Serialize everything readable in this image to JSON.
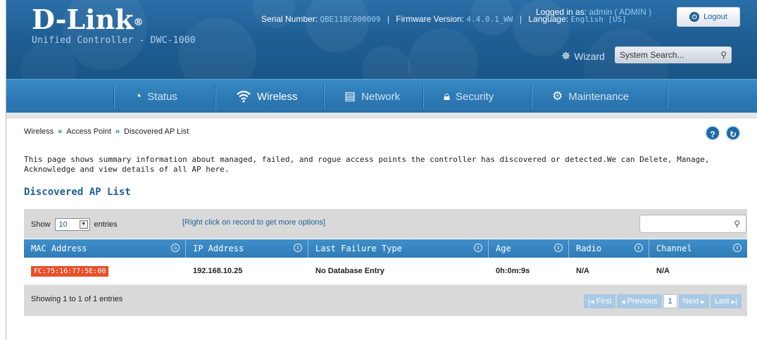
{
  "header": {
    "brand": "D-Link",
    "brand_mark": "®",
    "subtitle": "Unified Controller - DWC-1000",
    "serial_label": "Serial Number:",
    "serial_value": "QBE11BC000009",
    "firmware_label": "Firmware Version:",
    "firmware_value": "4.4.0.1_WW",
    "language_label": "Language:",
    "language_value": "English [US]",
    "logged_label": "Logged in as:",
    "logged_value": "admin ( ADMIN )",
    "logout_label": "Logout",
    "wizard_label": "Wizard",
    "search_placeholder": "System Search..."
  },
  "nav": {
    "items": [
      {
        "label": "Status",
        "icon": "gauge-icon"
      },
      {
        "label": "Wireless",
        "icon": "wifi-icon"
      },
      {
        "label": "Network",
        "icon": "monitor-icon"
      },
      {
        "label": "Security",
        "icon": "lock-icon"
      },
      {
        "label": "Maintenance",
        "icon": "gears-icon"
      }
    ],
    "active": "Wireless"
  },
  "breadcrumb": [
    "Wireless",
    "Access Point",
    "Discovered AP List"
  ],
  "help_icons": [
    "?",
    "↻"
  ],
  "description": "This page shows summary information about managed, failed, and rogue access points the controller has discovered or detected.We can Delete, Manage, Acknowledge and view details of all AP here.",
  "section_title": "Discovered AP List",
  "table": {
    "show_label": "Show",
    "show_value": "10",
    "entries_label": "entries",
    "hint": "[Right click on record to get more options]",
    "columns": [
      "MAC Address",
      "IP Address",
      "Last Failure Type",
      "Age",
      "Radio",
      "Channel"
    ],
    "rows": [
      {
        "mac": "FC:75:16:77:5E:00",
        "ip": "192.168.10.25",
        "failure": "No Database Entry",
        "age": "0h:0m:9s",
        "radio": "N/A",
        "channel": "N/A"
      }
    ],
    "footer_info": "Showing 1 to 1 of 1 entries",
    "pager": {
      "first": "First",
      "previous": "Previous",
      "current": "1",
      "next": "Next",
      "last": "Last"
    }
  },
  "colors": {
    "header": "#1f5f96",
    "nav": "#2c79b4",
    "accent": "#e8502a"
  }
}
